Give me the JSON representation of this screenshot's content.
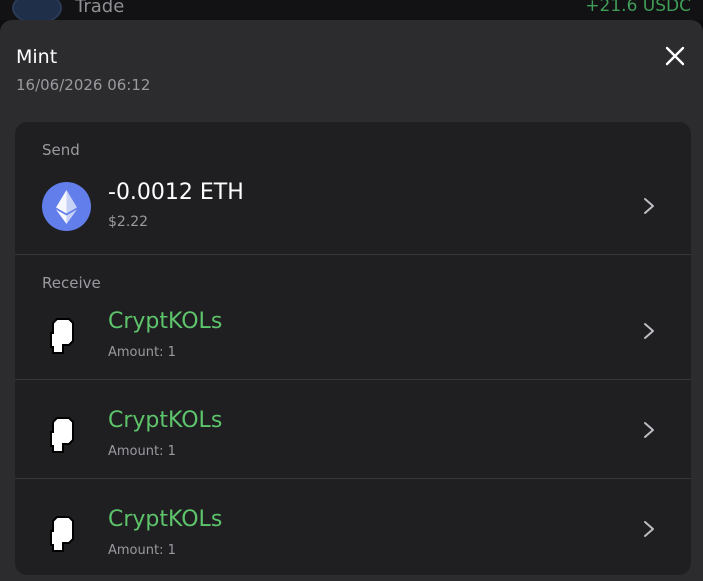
{
  "background": {
    "title": "Trade",
    "amount": "+21.6 USDC"
  },
  "sheet": {
    "title": "Mint",
    "date": "16/06/2026 06:12"
  },
  "send": {
    "label": "Send",
    "amount": "-0.0012 ETH",
    "fiat": "$2.22",
    "icon": "ethereum-icon"
  },
  "receive": {
    "label": "Receive",
    "items": [
      {
        "name": "CryptKOLs",
        "amount": "Amount: 1",
        "icon": "nft-avatar-icon"
      },
      {
        "name": "CryptKOLs",
        "amount": "Amount: 1",
        "icon": "nft-avatar-icon"
      },
      {
        "name": "CryptKOLs",
        "amount": "Amount: 1",
        "icon": "nft-avatar-icon"
      }
    ]
  },
  "colors": {
    "sheet_bg": "#2c2c2e",
    "card_bg": "#1f1f21",
    "nft_name": "#5dc46c",
    "eth_blue": "#627eea",
    "positive": "#3f9d58"
  }
}
